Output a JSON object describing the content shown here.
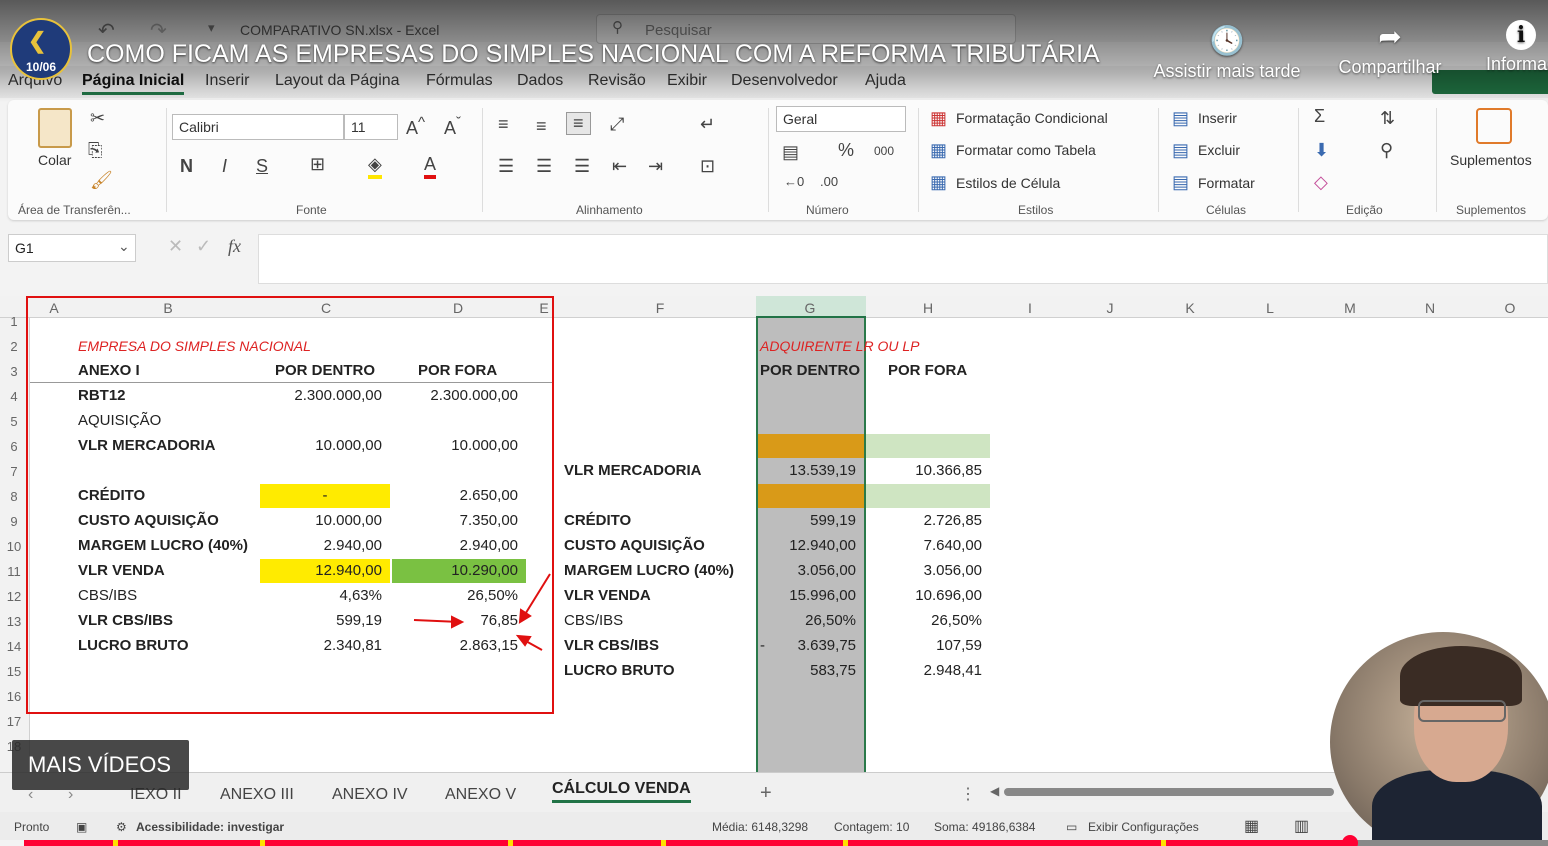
{
  "window": {
    "file_title": "COMPARATIVO SN.xlsx  -  Excel",
    "search_placeholder": "Pesquisar"
  },
  "video": {
    "title": "COMO FICAM AS EMPRESAS DO SIMPLES NACIONAL COM A REFORMA TRIBUTÁRIA",
    "channel_badge_date": "10/06",
    "actions": {
      "watch_later": "Assistir mais tarde",
      "share": "Compartilhar",
      "info": "Informaç"
    },
    "more_videos": "MAIS VÍDEOS"
  },
  "menu": {
    "tabs": [
      "Arquivo",
      "Página Inicial",
      "Inserir",
      "Layout da Página",
      "Fórmulas",
      "Dados",
      "Revisão",
      "Exibir",
      "Desenvolvedor",
      "Ajuda"
    ],
    "active": "Página Inicial"
  },
  "ribbon": {
    "clipboard": {
      "paste": "Colar",
      "group": "Área de Transferên..."
    },
    "font": {
      "name": "Calibri",
      "size": "11",
      "bold": "N",
      "italic": "I",
      "underline": "S",
      "group": "Fonte"
    },
    "alignment": {
      "group": "Alinhamento"
    },
    "number": {
      "format": "Geral",
      "group": "Número"
    },
    "styles": {
      "conditional": "Formatação Condicional",
      "as_table": "Formatar como Tabela",
      "cell_styles": "Estilos de Célula",
      "group": "Estilos"
    },
    "cells": {
      "insert": "Inserir",
      "delete": "Excluir",
      "format": "Formatar",
      "group": "Células"
    },
    "editing": {
      "group": "Edição"
    },
    "addins": {
      "label": "Suplementos",
      "group": "Suplementos"
    }
  },
  "formula_bar": {
    "name_box": "G1",
    "fx": "fx",
    "content": ""
  },
  "columns": [
    "A",
    "B",
    "C",
    "D",
    "E",
    "F",
    "G",
    "H",
    "I",
    "J",
    "K",
    "L",
    "M",
    "N",
    "O"
  ],
  "rows": [
    "1",
    "2",
    "3",
    "4",
    "5",
    "6",
    "7",
    "8",
    "9",
    "10",
    "11",
    "12",
    "13",
    "14",
    "15",
    "16",
    "17",
    "18"
  ],
  "left_table": {
    "title": "EMPRESA DO SIMPLES NACIONAL",
    "header": [
      "ANEXO I",
      "POR DENTRO",
      "POR FORA"
    ],
    "rows": [
      [
        "RBT12",
        "2.300.000,00",
        "2.300.000,00"
      ],
      [
        "AQUISIÇÃO",
        "",
        ""
      ],
      [
        "VLR MERCADORIA",
        "10.000,00",
        "10.000,00"
      ],
      [
        "",
        "",
        ""
      ],
      [
        "CRÉDITO",
        "-",
        "2.650,00"
      ],
      [
        "CUSTO AQUISIÇÃO",
        "10.000,00",
        "7.350,00"
      ],
      [
        "MARGEM LUCRO (40%)",
        "2.940,00",
        "2.940,00"
      ],
      [
        "VLR VENDA",
        "12.940,00",
        "10.290,00"
      ],
      [
        "CBS/IBS",
        "4,63%",
        "26,50%"
      ],
      [
        "VLR CBS/IBS",
        "599,19",
        "76,85"
      ],
      [
        "LUCRO BRUTO",
        "2.340,81",
        "2.863,15"
      ]
    ]
  },
  "right_table": {
    "title": "ADQUIRENTE LR OU LP",
    "header": [
      "POR DENTRO",
      "POR FORA"
    ],
    "rows": [
      [
        "VLR MERCADORIA",
        "13.539,19",
        "10.366,85"
      ],
      [
        "CRÉDITO",
        "599,19",
        "2.726,85"
      ],
      [
        "CUSTO AQUISIÇÃO",
        "12.940,00",
        "7.640,00"
      ],
      [
        "MARGEM LUCRO (40%)",
        "3.056,00",
        "3.056,00"
      ],
      [
        "VLR VENDA",
        "15.996,00",
        "10.696,00"
      ],
      [
        "CBS/IBS",
        "26,50%",
        "26,50%"
      ],
      [
        "VLR CBS/IBS",
        "3.639,75",
        "107,59"
      ],
      [
        "LUCRO BRUTO",
        "583,75",
        "2.948,41"
      ]
    ],
    "lucro_prefix": "-"
  },
  "sheet_tabs": [
    "IEXO II",
    "ANEXO III",
    "ANEXO IV",
    "ANEXO V",
    "CÁLCULO VENDA"
  ],
  "active_sheet": "CÁLCULO VENDA",
  "status": {
    "ready": "Pronto",
    "accessibility": "Acessibilidade: investigar",
    "average": "Média: 6148,3298",
    "count": "Contagem: 10",
    "sum": "Soma: 49186,6384",
    "display": "Exibir Configurações"
  },
  "playback": {
    "progress": 0.87
  },
  "colors": {
    "excel_green": "#217346",
    "yellow": "#ffeb00",
    "green": "#7ac142",
    "orange": "#d99a18",
    "light_green": "#cfe5c2",
    "highlight_red": "#e01010",
    "yt_red": "#ff0033"
  }
}
